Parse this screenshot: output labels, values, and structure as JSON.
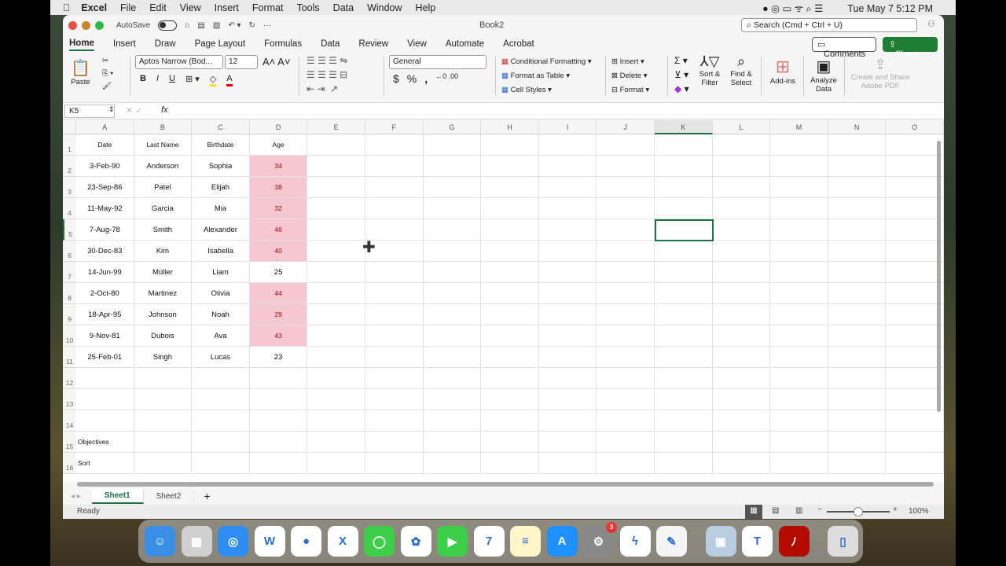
{
  "menubar": {
    "app": "Excel",
    "items": [
      "File",
      "Edit",
      "View",
      "Insert",
      "Format",
      "Tools",
      "Data",
      "Window",
      "Help"
    ],
    "clock": "Tue May 7  5:12 PM"
  },
  "titlebar": {
    "autosave": "AutoSave",
    "autosave_on": false,
    "title": "Book2",
    "search_placeholder": "Search (Cmd + Ctrl + U)"
  },
  "tabs": [
    "Home",
    "Insert",
    "Draw",
    "Page Layout",
    "Formulas",
    "Data",
    "Review",
    "View",
    "Automate",
    "Acrobat"
  ],
  "active_tab": "Home",
  "buttons": {
    "comments": "Comments",
    "share": "Share"
  },
  "ribbon": {
    "paste": "Paste",
    "font": "Aptos Narrow (Bod...",
    "size": "12",
    "bold": "B",
    "italic": "I",
    "underline": "U",
    "number_format": "General",
    "conditional": "Conditional Formatting",
    "format_table": "Format as Table",
    "cell_styles": "Cell Styles",
    "insert": "Insert",
    "delete": "Delete",
    "format": "Format",
    "sort": "Sort & Filter",
    "find": "Find & Select",
    "addins": "Add-ins",
    "analyze": "Analyze Data",
    "adobe": "Create and Share Adobe PDF",
    "currency": "$",
    "percent": "%",
    "comma": ","
  },
  "formula_bar": {
    "name_box": "K5",
    "fx": "fx",
    "value": ""
  },
  "columns": [
    "A",
    "B",
    "C",
    "D",
    "E",
    "F",
    "G",
    "H",
    "I",
    "J",
    "K",
    "L",
    "M",
    "N",
    "O"
  ],
  "selected_cell": "K5",
  "rows": [
    [
      "Date",
      "Last Name",
      "Birthdate",
      "Age"
    ],
    [
      "3-Feb-90",
      "Anderson",
      "Sophia",
      "34"
    ],
    [
      "23-Sep-86",
      "Patel",
      "Elijah",
      "38"
    ],
    [
      "11-May-92",
      "Garcia",
      "Mia",
      "32"
    ],
    [
      "7-Aug-78",
      "Smith",
      "Alexander",
      "46"
    ],
    [
      "30-Dec-83",
      "Kim",
      "Isabella",
      "40"
    ],
    [
      "14-Jun-99",
      "Müller",
      "Liam",
      "25"
    ],
    [
      "2-Oct-80",
      "Martinez",
      "Olivia",
      "44"
    ],
    [
      "18-Apr-95",
      "Johnson",
      "Noah",
      "29"
    ],
    [
      "9-Nov-81",
      "Dubois",
      "Ava",
      "43"
    ],
    [
      "25-Feb-01",
      "Singh",
      "Lucas",
      "23"
    ],
    [
      "",
      "",
      "",
      ""
    ],
    [
      "",
      "",
      "",
      ""
    ],
    [
      "",
      "",
      "",
      ""
    ],
    [
      "Objectives",
      "",
      "",
      ""
    ],
    [
      "Sort",
      "",
      "",
      ""
    ]
  ],
  "highlighted_rows": [
    2,
    3,
    4,
    5,
    6,
    8,
    9,
    10
  ],
  "highlight_color": "#f6c7cf",
  "sheets": [
    "Sheet1",
    "Sheet2"
  ],
  "active_sheet": "Sheet1",
  "add_sheet": "+",
  "status": {
    "text": "Ready",
    "zoom": "100%",
    "zoom_fraction": 0.5
  },
  "dock": [
    {
      "name": "finder",
      "bg": "#3a8ee6",
      "glyph": "☺"
    },
    {
      "name": "launchpad",
      "bg": "#d0d0d0",
      "glyph": "▦"
    },
    {
      "name": "safari",
      "bg": "#2d8cf0",
      "glyph": "◎"
    },
    {
      "name": "word",
      "bg": "#fff",
      "glyph": "W"
    },
    {
      "name": "chrome",
      "bg": "#fff",
      "glyph": "●"
    },
    {
      "name": "excel",
      "bg": "#fff",
      "glyph": "X"
    },
    {
      "name": "messages",
      "bg": "#3ecf4a",
      "glyph": "◯"
    },
    {
      "name": "photos",
      "bg": "#fff",
      "glyph": "✿"
    },
    {
      "name": "facetime",
      "bg": "#3ecf4a",
      "glyph": "▶"
    },
    {
      "name": "calendar",
      "bg": "#fff",
      "glyph": "7"
    },
    {
      "name": "notes",
      "bg": "#fff6c8",
      "glyph": "≡"
    },
    {
      "name": "app-store",
      "bg": "#1e90ff",
      "glyph": "A"
    },
    {
      "name": "system-settings",
      "bg": "#888",
      "glyph": "⚙",
      "badge": "3"
    },
    {
      "name": "messenger",
      "bg": "#fff",
      "glyph": "ϟ"
    },
    {
      "name": "textedit",
      "bg": "#f4f4f4",
      "glyph": "✎"
    },
    {
      "name": "preview",
      "bg": "#b8cde0",
      "glyph": "▣"
    },
    {
      "name": "teams",
      "bg": "#fff",
      "glyph": "T"
    },
    {
      "name": "acrobat",
      "bg": "#b30b00",
      "glyph": "ﾉ"
    },
    {
      "name": "trash",
      "bg": "#ddd",
      "glyph": "▯"
    }
  ]
}
